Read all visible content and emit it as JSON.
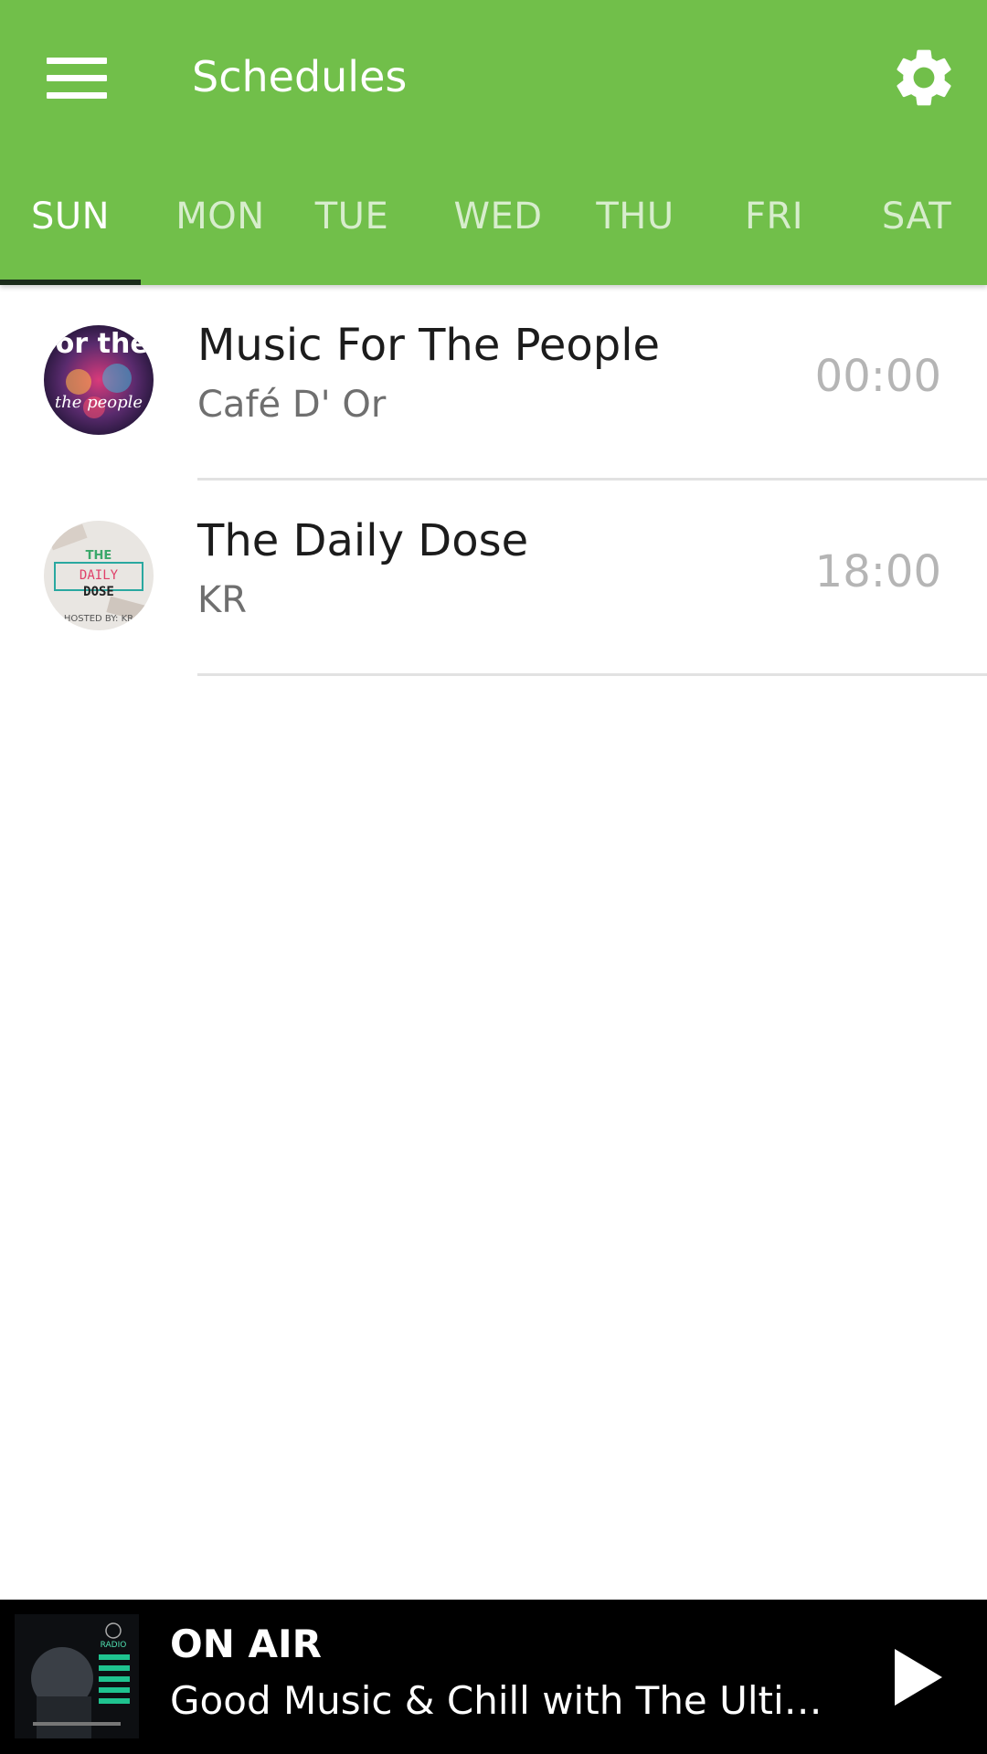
{
  "header": {
    "title": "Schedules",
    "bg_color": "#71bf4a",
    "menu_icon": "hamburger-menu-icon",
    "settings_icon": "gear-icon"
  },
  "tabs": [
    {
      "label": "SUN",
      "active": true
    },
    {
      "label": "MON",
      "active": false
    },
    {
      "label": "TUE",
      "active": false
    },
    {
      "label": "WED",
      "active": false
    },
    {
      "label": "THU",
      "active": false
    },
    {
      "label": "FRI",
      "active": false
    },
    {
      "label": "SAT",
      "active": false
    }
  ],
  "schedule": [
    {
      "title": "Music For The People",
      "host": "Café D' Or",
      "time": "00:00",
      "art_text": "MUSIC for the people"
    },
    {
      "title": "The Daily Dose",
      "host": "KR",
      "time": "18:00",
      "art_text": "THE DAILY DOSE HOSTED BY KR"
    }
  ],
  "player": {
    "status": "ON AIR",
    "now_playing": "Good Music & Chill with The Ultima...",
    "play_icon": "play-icon"
  }
}
